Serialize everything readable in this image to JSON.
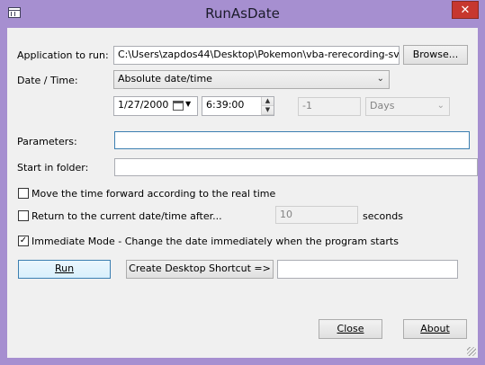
{
  "window": {
    "title": "RunAsDate",
    "close_glyph": "✕"
  },
  "form": {
    "application_label": "Application to run:",
    "application_value": "C:\\Users\\zapdos44\\Desktop\\Pokemon\\vba-rerecording-svn480-w",
    "browse_label": "Browse...",
    "datetime_label": "Date / Time:",
    "datetime_mode": "Absolute date/time",
    "date_value": "1/27/2000",
    "time_value": "6:39:00",
    "offset_value": "-1",
    "offset_unit": "Days",
    "parameters_label": "Parameters:",
    "parameters_value": "",
    "start_folder_label": "Start in folder:",
    "start_folder_value": "",
    "move_time_label": "Move the time forward according to the real time",
    "move_time_checked": false,
    "return_label": "Return to the current date/time after...",
    "return_checked": false,
    "return_seconds": "10",
    "seconds_label": "seconds",
    "immediate_label": "Immediate Mode - Change the date immediately when the program starts",
    "immediate_checked": true,
    "immediate_check_glyph": "✓"
  },
  "buttons": {
    "run": "Run",
    "create_shortcut": "Create Desktop Shortcut =>",
    "shortcut_name": "",
    "close": "Close",
    "about": "About"
  },
  "colors": {
    "frame": "#a68fd0",
    "client": "#f0f0f0",
    "close_button": "#c7372f"
  }
}
